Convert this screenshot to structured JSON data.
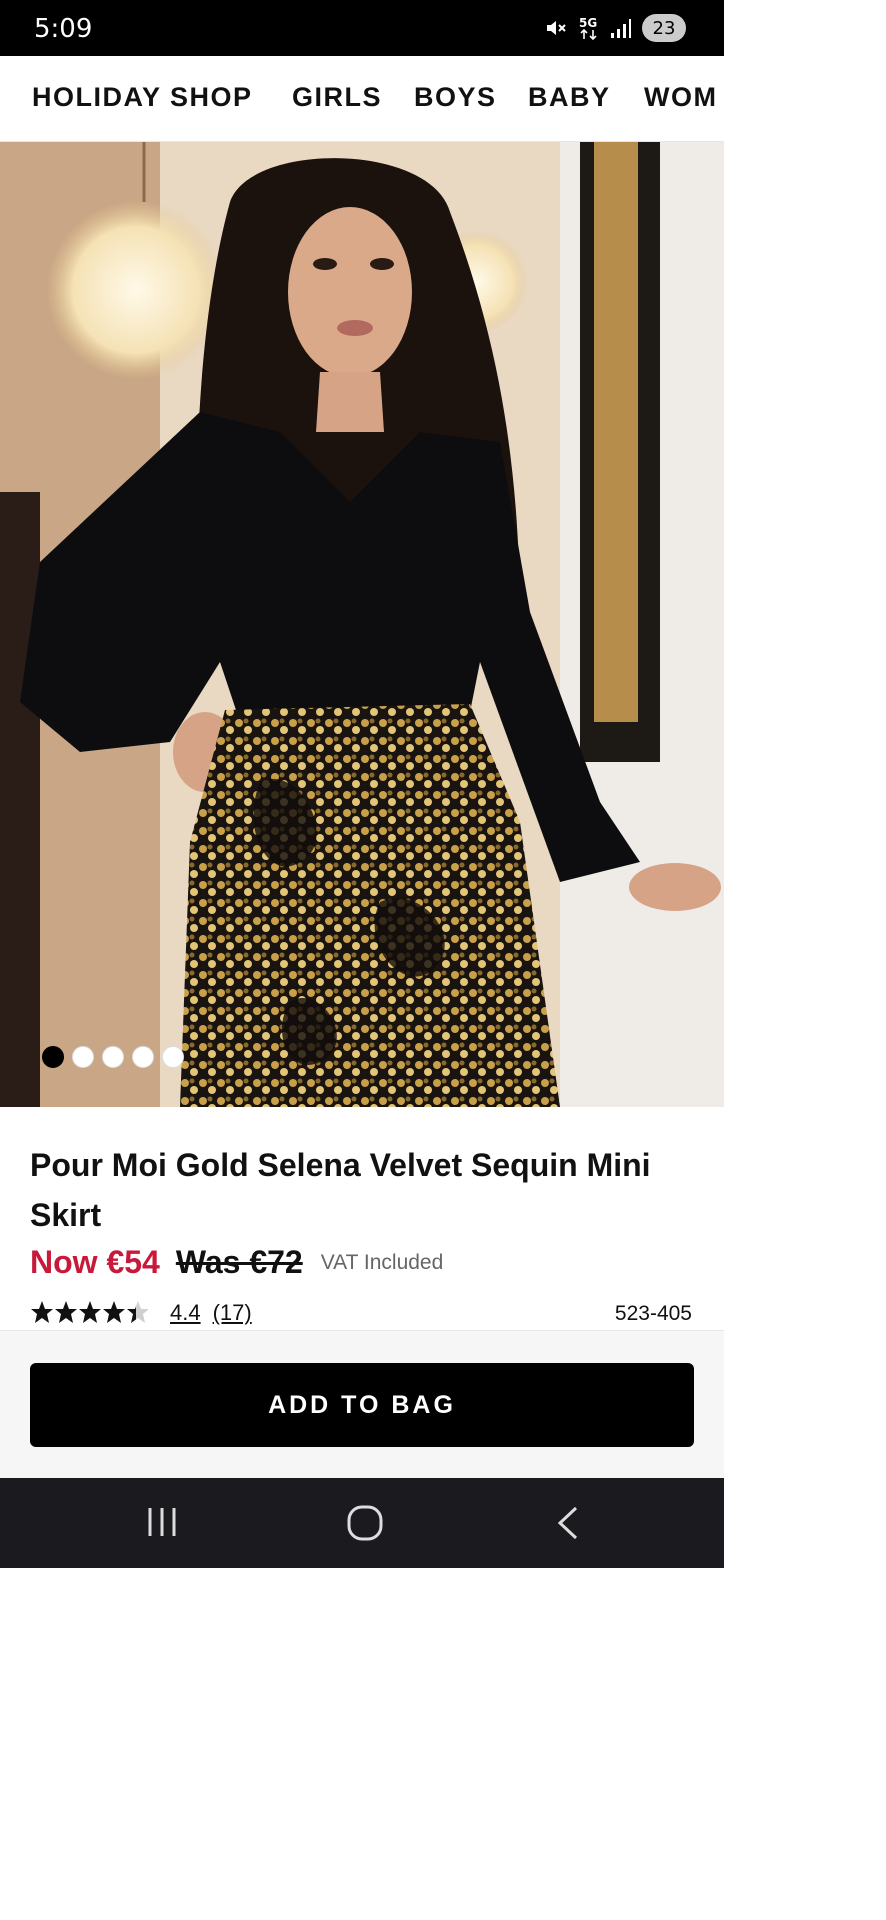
{
  "status_bar": {
    "time": "5:09",
    "network": "5G",
    "battery": "23",
    "icons": [
      "mute-icon",
      "5g-icon",
      "signal-icon",
      "battery-icon"
    ]
  },
  "nav": {
    "items": [
      "HOLIDAY SHOP",
      "GIRLS",
      "BOYS",
      "BABY",
      "WOM"
    ]
  },
  "gallery": {
    "image_count": 5,
    "active_index": 0
  },
  "product": {
    "title": "Pour Moi Gold Selena Velvet Sequin Mini Skirt",
    "price_now": "Now €54",
    "price_was": "Was €72",
    "vat_note": "VAT Included",
    "rating": "4.4",
    "rating_count": "(17)",
    "rating_stars": 4.4,
    "sku": "523-405"
  },
  "actions": {
    "add_to_bag": "ADD TO BAG"
  },
  "colors": {
    "sale_price": "#c8193a",
    "button_bg": "#000000",
    "system_nav_bg": "#1a1a1f"
  },
  "system_nav": {
    "icons": [
      "recent-apps-icon",
      "home-icon",
      "back-icon"
    ]
  }
}
